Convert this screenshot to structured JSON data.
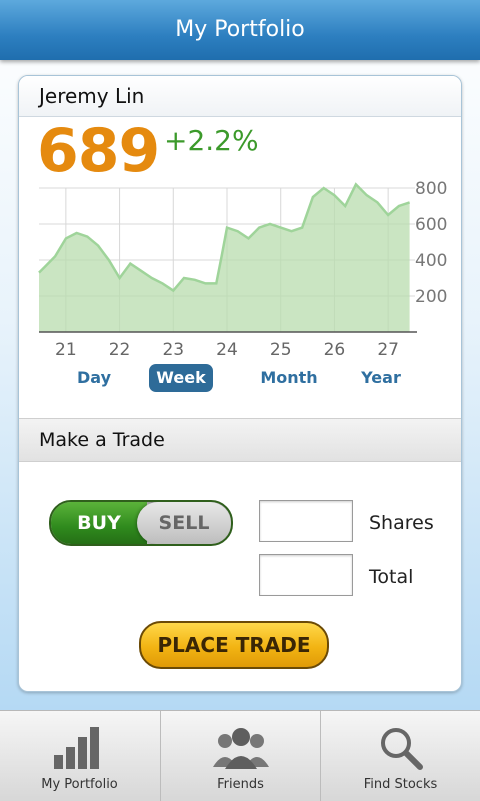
{
  "header": {
    "title": "My Portfolio"
  },
  "profile": {
    "name": "Jeremy Lin",
    "score": "689",
    "change": "+2.2%"
  },
  "chart_data": {
    "type": "area",
    "x": [
      20.5,
      20.6,
      20.8,
      21.0,
      21.2,
      21.4,
      21.6,
      21.8,
      22.0,
      22.2,
      22.4,
      22.5,
      22.6,
      22.8,
      23.0,
      23.2,
      23.4,
      23.6,
      23.8,
      23.9,
      24.0,
      24.2,
      24.4,
      24.6,
      24.8,
      25.0,
      25.2,
      25.4,
      25.6,
      25.8,
      26.0,
      26.2,
      26.4,
      26.6,
      26.8,
      27.0,
      27.2,
      27.4
    ],
    "y": [
      330,
      360,
      420,
      520,
      550,
      530,
      480,
      400,
      300,
      380,
      340,
      320,
      300,
      270,
      230,
      300,
      290,
      270,
      270,
      420,
      580,
      560,
      520,
      580,
      600,
      580,
      560,
      580,
      750,
      800,
      760,
      700,
      820,
      760,
      720,
      650,
      700,
      720
    ],
    "x_ticks": [
      "21",
      "22",
      "23",
      "24",
      "25",
      "26",
      "27"
    ],
    "y_ticks": [
      "200",
      "400",
      "600",
      "800"
    ],
    "xlim": [
      20.5,
      27.5
    ],
    "ylim": [
      0,
      800
    ],
    "grid": true,
    "colors": {
      "fill": "#b8dcae",
      "line": "#9fd49a"
    }
  },
  "ranges": [
    {
      "label": "Day",
      "active": false
    },
    {
      "label": "Week",
      "active": true
    },
    {
      "label": "Month",
      "active": false
    },
    {
      "label": "Year",
      "active": false
    }
  ],
  "trade": {
    "title": "Make a Trade",
    "buy_label": "BUY",
    "sell_label": "SELL",
    "shares_label": "Shares",
    "total_label": "Total",
    "shares_value": "",
    "total_value": "",
    "place_label": "PLACE TRADE"
  },
  "tabs": [
    {
      "label": "My Portfolio",
      "icon": "bar-chart-icon"
    },
    {
      "label": "Friends",
      "icon": "friends-icon"
    },
    {
      "label": "Find Stocks",
      "icon": "magnifier-icon"
    }
  ]
}
